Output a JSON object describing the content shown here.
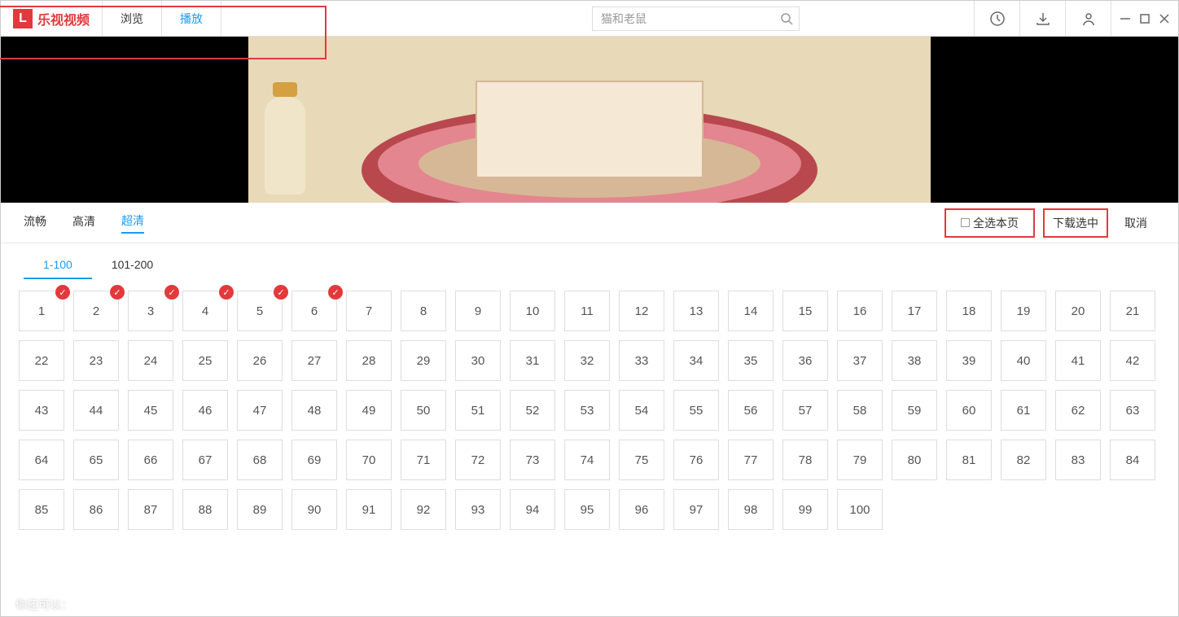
{
  "header": {
    "logo_glyph": "L",
    "logo_text": "乐视视频",
    "tabs": {
      "browse": "浏览",
      "play": "播放"
    },
    "search_value": "猫和老鼠"
  },
  "quality": {
    "smooth": "流畅",
    "hd": "高清",
    "uhd": "超清"
  },
  "actions": {
    "select_all": "全选本页",
    "download": "下载选中",
    "cancel": "取消"
  },
  "ranges": {
    "r1": "1-100",
    "r2": "101-200"
  },
  "episodes_count": 100,
  "checked_episodes": [
    1,
    2,
    3,
    4,
    5,
    6
  ],
  "footer": "你还可以："
}
